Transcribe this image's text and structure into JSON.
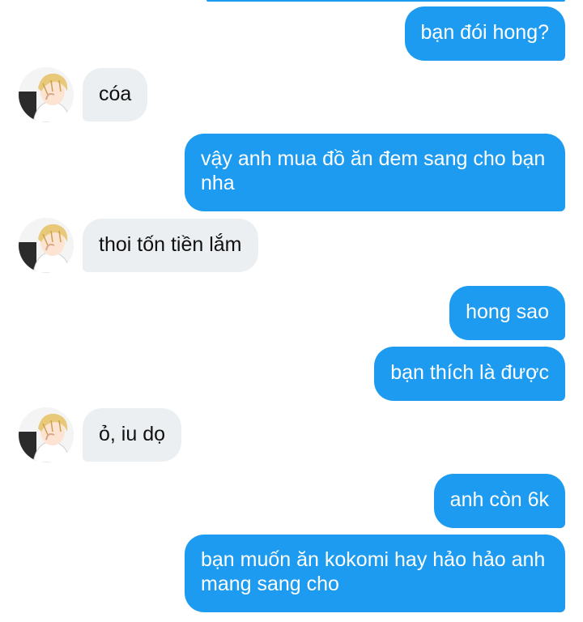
{
  "conversation": {
    "messages": [
      {
        "side": "out",
        "text": "bạn đói hong?"
      },
      {
        "side": "in",
        "text": "cóa"
      },
      {
        "side": "out",
        "text": "vậy anh mua đồ ăn đem sang cho bạn nha"
      },
      {
        "side": "in",
        "text": "thoi tốn tiền lắm"
      },
      {
        "side": "out",
        "text": "hong sao"
      },
      {
        "side": "out",
        "text": "bạn thích là được"
      },
      {
        "side": "in",
        "text": "ỏ, iu dọ"
      },
      {
        "side": "out",
        "text": "anh còn 6k"
      },
      {
        "side": "out",
        "text": "bạn muốn ăn kokomi hay hảo hảo anh mang sang cho"
      }
    ]
  },
  "colors": {
    "outgoing_bubble": "#1d9bf0",
    "incoming_bubble": "#eceff1"
  }
}
